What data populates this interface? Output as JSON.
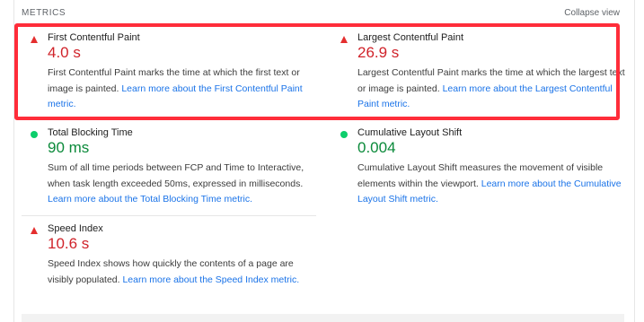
{
  "header": {
    "section_label": "METRICS",
    "collapse_label": "Collapse view"
  },
  "colors": {
    "fail": "#d0232a",
    "pass": "#0b8a3a",
    "highlight": "#ff2d3a",
    "link": "#1a73e8"
  },
  "metrics": {
    "fcp": {
      "status": "fail",
      "title": "First Contentful Paint",
      "value": "4.0 s",
      "desc": "First Contentful Paint marks the time at which the first text or image is painted. ",
      "link": "Learn more about the First Contentful Paint metric."
    },
    "lcp": {
      "status": "fail",
      "title": "Largest Contentful Paint",
      "value": "26.9 s",
      "desc": "Largest Contentful Paint marks the time at which the largest text or image is painted. ",
      "link": "Learn more about the Largest Contentful Paint metric."
    },
    "tbt": {
      "status": "pass",
      "title": "Total Blocking Time",
      "value": "90 ms",
      "desc": "Sum of all time periods between FCP and Time to Interactive, when task length exceeded 50ms, expressed in milliseconds. ",
      "link": "Learn more about the Total Blocking Time metric."
    },
    "cls": {
      "status": "pass",
      "title": "Cumulative Layout Shift",
      "value": "0.004",
      "desc": "Cumulative Layout Shift measures the movement of visible elements within the viewport. ",
      "link": "Learn more about the Cumulative Layout Shift metric."
    },
    "si": {
      "status": "fail",
      "title": "Speed Index",
      "value": "10.6 s",
      "desc": "Speed Index shows how quickly the contents of a page are visibly populated. ",
      "link": "Learn more about the Speed Index metric."
    }
  }
}
